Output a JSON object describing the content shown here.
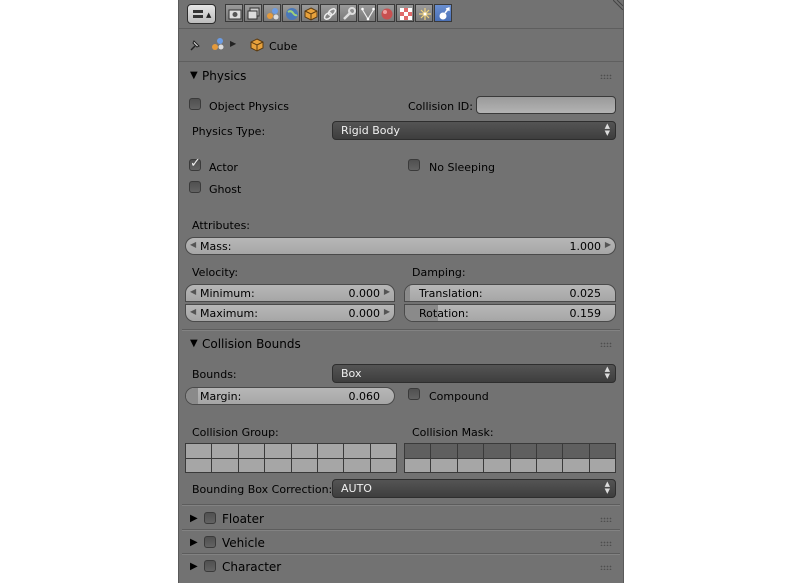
{
  "breadcrumb": {
    "object_name": "Cube"
  },
  "physics": {
    "title": "Physics",
    "object_physics_label": "Object Physics",
    "collision_id_label": "Collision ID:",
    "collision_id_value": "",
    "physics_type_label": "Physics Type:",
    "physics_type_value": "Rigid Body",
    "actor_label": "Actor",
    "actor_checked": true,
    "no_sleeping_label": "No Sleeping",
    "ghost_label": "Ghost",
    "attributes_label": "Attributes:",
    "mass_label": "Mass:",
    "mass_value": "1.000",
    "velocity_label": "Velocity:",
    "velocity_min_label": "Minimum:",
    "velocity_min_value": "0.000",
    "velocity_max_label": "Maximum:",
    "velocity_max_value": "0.000",
    "damping_label": "Damping:",
    "translation_label": "Translation:",
    "translation_value": "0.025",
    "rotation_label": "Rotation:",
    "rotation_value": "0.159"
  },
  "collision_bounds": {
    "title": "Collision Bounds",
    "bounds_label": "Bounds:",
    "bounds_value": "Box",
    "margin_label": "Margin:",
    "margin_value": "0.060",
    "compound_label": "Compound",
    "collision_group_label": "Collision Group:",
    "collision_group_on": [
      0,
      0,
      0,
      0,
      0,
      0,
      0,
      0,
      0,
      0,
      0,
      0,
      0,
      0,
      0,
      0
    ],
    "collision_mask_label": "Collision Mask:",
    "collision_mask_on": [
      1,
      1,
      1,
      1,
      1,
      1,
      1,
      1,
      0,
      0,
      0,
      0,
      0,
      0,
      0,
      0
    ],
    "bbox_correction_label": "Bounding Box Correction:",
    "bbox_correction_value": "AUTO"
  },
  "collapsed_panels": {
    "floater": "Floater",
    "vehicle": "Vehicle",
    "character": "Character"
  },
  "icons": [
    "editor-type-icon",
    "render-icon",
    "render-layers-icon",
    "scene-icon",
    "world-icon",
    "object-icon",
    "constraints-icon",
    "modifiers-icon",
    "data-icon",
    "material-icon",
    "texture-icon",
    "particles-icon",
    "physics-icon",
    "pin-icon",
    "cube-icon"
  ],
  "colors": {
    "panel_bg": "#727272",
    "dropdown_bg": "#474747",
    "active_tab": "#5680c2",
    "field_bg": "#adadad"
  }
}
